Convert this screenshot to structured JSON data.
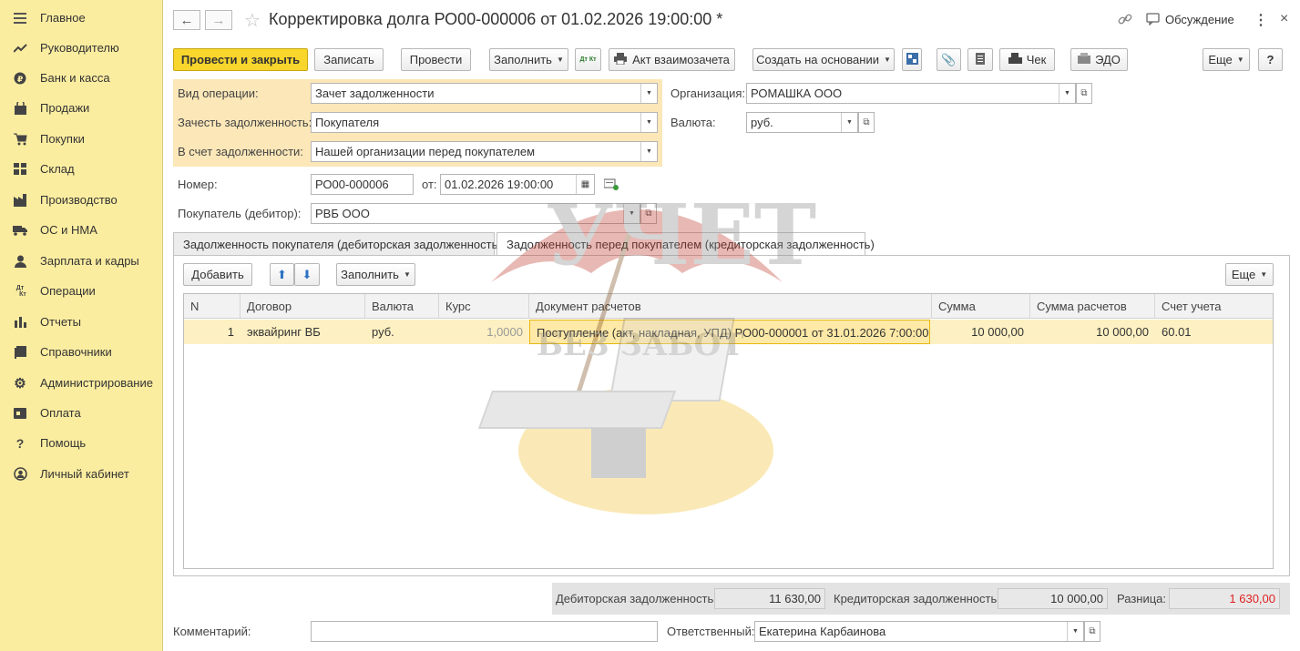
{
  "sidebar": {
    "items": [
      {
        "label": "Главное",
        "icon": "menu-icon"
      },
      {
        "label": "Руководителю",
        "icon": "trend-icon"
      },
      {
        "label": "Банк и касса",
        "icon": "coin-icon"
      },
      {
        "label": "Продажи",
        "icon": "bag-icon"
      },
      {
        "label": "Покупки",
        "icon": "cart-icon"
      },
      {
        "label": "Склад",
        "icon": "warehouse-icon"
      },
      {
        "label": "Производство",
        "icon": "factory-icon"
      },
      {
        "label": "ОС и НМА",
        "icon": "truck-icon"
      },
      {
        "label": "Зарплата и кадры",
        "icon": "person-icon"
      },
      {
        "label": "Операции",
        "icon": "dt-kt-icon"
      },
      {
        "label": "Отчеты",
        "icon": "bar-chart-icon"
      },
      {
        "label": "Справочники",
        "icon": "book-icon"
      },
      {
        "label": "Администрирование",
        "icon": "gear-icon"
      },
      {
        "label": "Оплата",
        "icon": "wallet-icon"
      },
      {
        "label": "Помощь",
        "icon": "question-icon"
      },
      {
        "label": "Личный кабинет",
        "icon": "account-icon"
      }
    ]
  },
  "header": {
    "title": "Корректировка долга РО00-000006 от 01.02.2026 19:00:00 *",
    "discussion": "Обсуждение"
  },
  "toolbar": {
    "post_close": "Провести и закрыть",
    "save": "Записать",
    "post": "Провести",
    "fill": "Заполнить",
    "dtkt": "Дт Кт",
    "act": "Акт взаимозачета",
    "create_based": "Создать на основании",
    "check": "Чек",
    "edo": "ЭДО",
    "more": "Еще",
    "help": "?"
  },
  "form": {
    "op_type_label": "Вид операции:",
    "op_type_value": "Зачет задолженности",
    "offset_label": "Зачесть задолженность:",
    "offset_value": "Покупателя",
    "against_label": "В счет задолженности:",
    "against_value": "Нашей организации перед покупателем",
    "org_label": "Организация:",
    "org_value": "РОМАШКА ООО",
    "currency_label": "Валюта:",
    "currency_value": "руб.",
    "number_label": "Номер:",
    "number_value": "РО00-000006",
    "date_label": "от:",
    "date_value": "01.02.2026 19:00:00",
    "buyer_label": "Покупатель (дебитор):",
    "buyer_value": "РВБ ООО"
  },
  "tabs": [
    {
      "label": "Задолженность покупателя (дебиторская задолженность)"
    },
    {
      "label": "Задолженность перед покупателем (кредиторская задолженность)"
    }
  ],
  "table_toolbar": {
    "add": "Добавить",
    "fill": "Заполнить",
    "more": "Еще"
  },
  "table": {
    "columns": [
      "N",
      "Договор",
      "Валюта",
      "Курс",
      "Документ расчетов",
      "Сумма",
      "Сумма расчетов",
      "Счет учета"
    ],
    "rows": [
      {
        "n": "1",
        "contract": "эквайринг ВБ",
        "currency": "руб.",
        "rate": "1,0000",
        "document": "Поступление (акт, накладная, УПД) РО00-000001 от 31.01.2026 7:00:00",
        "amount": "10 000,00",
        "settlement_amount": "10 000,00",
        "account": "60.01"
      }
    ]
  },
  "totals": {
    "debit_label": "Дебиторская задолженность:",
    "debit_value": "11 630,00",
    "credit_label": "Кредиторская задолженность:",
    "credit_value": "10 000,00",
    "diff_label": "Разница:",
    "diff_value": "1 630,00",
    "diff_color": "#e02020"
  },
  "bottom": {
    "comment_label": "Комментарий:",
    "comment_value": "",
    "responsible_label": "Ответственный:",
    "responsible_value": "Екатерина Карбаинова"
  },
  "watermark": {
    "line1": "УЧЕТ",
    "line2": "БЕЗ ЗАБОТ"
  },
  "colors": {
    "sidebar_bg": "#fbeda0",
    "primary_button": "#f8d62c",
    "highlight_group": "#fbe7b8",
    "selected_row": "#fdf0c2"
  }
}
